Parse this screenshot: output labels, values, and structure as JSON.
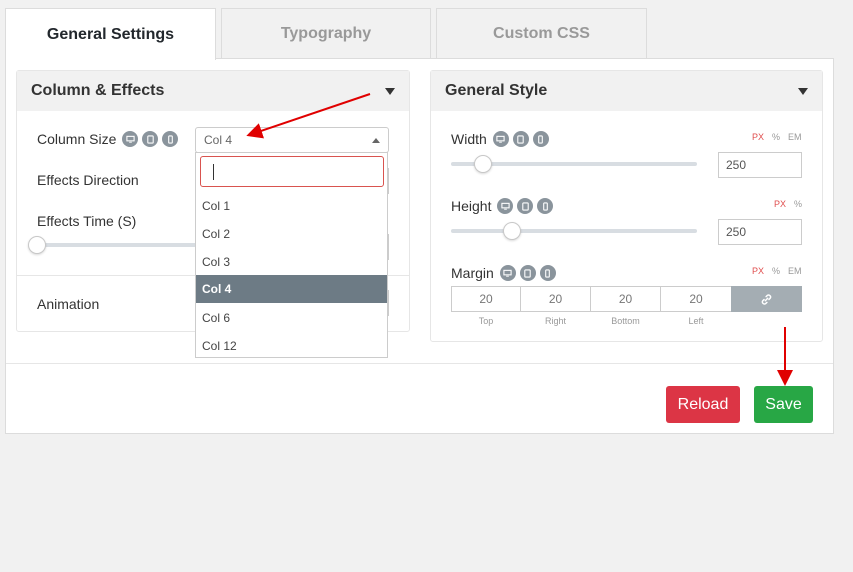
{
  "tabs": [
    {
      "label": "General Settings",
      "active": true
    },
    {
      "label": "Typography",
      "active": false
    },
    {
      "label": "Custom CSS",
      "active": false
    }
  ],
  "left_box": {
    "title": "Column & Effects",
    "column_size_label": "Column Size",
    "column_size_value": "Col 4",
    "effects_direction_label": "Effects Direction",
    "effects_time_label": "Effects Time (S)",
    "animation_label": "Animation",
    "dropdown": {
      "search_value": "",
      "options": [
        "Col 1",
        "Col 2",
        "Col 3",
        "Col 4",
        "Col 6",
        "Col 12"
      ],
      "selected": "Col 4"
    }
  },
  "right_box": {
    "title": "General Style",
    "width": {
      "label": "Width",
      "value": "250",
      "units": [
        "PX",
        "%",
        "EM"
      ],
      "active_unit": "PX"
    },
    "height": {
      "label": "Height",
      "value": "250",
      "units": [
        "PX",
        "%"
      ],
      "active_unit": "PX"
    },
    "margin": {
      "label": "Margin",
      "units": [
        "PX",
        "%",
        "EM"
      ],
      "active_unit": "PX",
      "values": [
        "20",
        "20",
        "20",
        "20"
      ],
      "sides": [
        "Top",
        "Right",
        "Bottom",
        "Left"
      ]
    }
  },
  "buttons": {
    "reload": "Reload",
    "save": "Save"
  },
  "colors": {
    "reload": "#dc3545",
    "save": "#28a745",
    "selected_option": "#6d7b85",
    "link_button": "#a4adb3",
    "annotation_arrow": "#e00000"
  },
  "icons": [
    "desktop-icon",
    "tablet-icon",
    "mobile-icon",
    "link-icon",
    "chevron-down-icon"
  ]
}
